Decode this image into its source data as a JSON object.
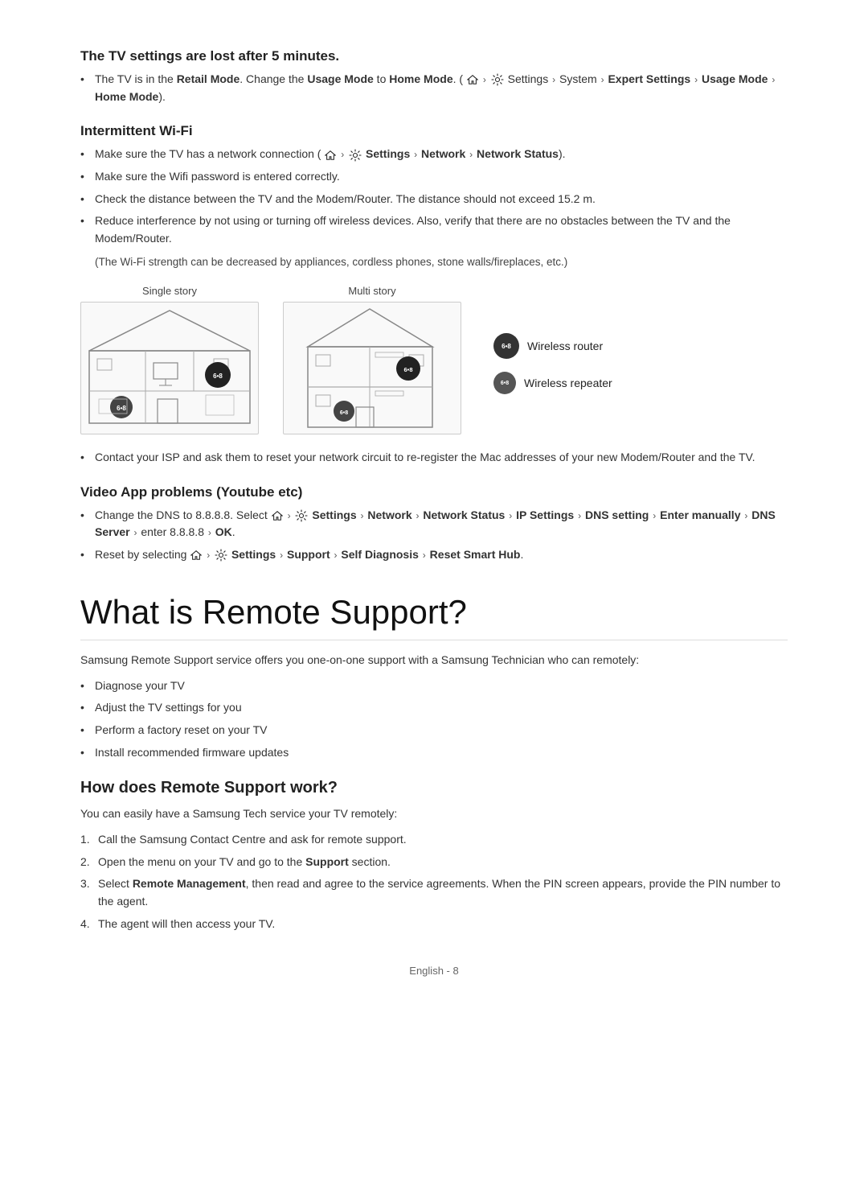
{
  "sections": {
    "tv_settings": {
      "title": "The TV settings are lost after 5 minutes.",
      "bullets": [
        {
          "text": "The TV is in the {bold:Retail Mode}. Change the {bold:Usage Mode} to {bold:Home Mode}. ({home} > {gear} Settings > System > {bold:Expert Settings} > {bold:Usage Mode} > {bold:Home Mode}).",
          "plain": "The TV is in the Retail Mode. Change the Usage Mode to Home Mode. ( > Settings > System > Expert Settings > Usage Mode > Home Mode)."
        }
      ]
    },
    "intermittent_wifi": {
      "title": "Intermittent Wi-Fi",
      "bullets": [
        "Make sure the TV has a network connection ( > Settings > Network > Network Status).",
        "Make sure the Wifi password is entered correctly.",
        "Check the distance between the TV and the Modem/Router. The distance should not exceed 15.2 m.",
        "Reduce interference by not using or turning off wireless devices. Also, verify that there are no obstacles between the TV and the Modem/Router."
      ],
      "note": "(The Wi-Fi strength can be decreased by appliances, cordless phones, stone walls/fireplaces, etc.)",
      "diagram": {
        "single_story_label": "Single story",
        "multi_story_label": "Multi story",
        "legend": {
          "router_label": "Wireless router",
          "repeater_label": "Wireless repeater"
        }
      },
      "contact_bullet": "Contact your ISP and ask them to reset your network circuit to re-register the Mac addresses of your new Modem/Router and the TV."
    },
    "video_app": {
      "title": "Video App problems (Youtube etc)",
      "bullets": [
        "Change the DNS to 8.8.8.8. Select  > Settings > Network > Network Status > IP Settings > DNS setting > Enter manually > DNS Server > enter 8.8.8.8 > OK.",
        "Reset by selecting  > Settings > Support > Self Diagnosis > Reset Smart Hub."
      ]
    },
    "remote_support": {
      "main_title": "What is Remote Support?",
      "intro": "Samsung Remote Support service offers you one-on-one support with a Samsung Technician who can remotely:",
      "bullets": [
        "Diagnose your TV",
        "Adjust the TV settings for you",
        "Perform a factory reset on your TV",
        "Install recommended firmware updates"
      ]
    },
    "how_remote": {
      "title": "How does Remote Support work?",
      "intro": "You can easily have a Samsung Tech service your TV remotely:",
      "steps": [
        "Call the Samsung Contact Centre and ask for remote support.",
        "Open the menu on your TV and go to the Support section.",
        "Select Remote Management, then read and agree to the service agreements. When the PIN screen appears, provide the PIN number to the agent.",
        "The agent will then access your TV."
      ]
    }
  },
  "footer": {
    "text": "English - 8"
  }
}
